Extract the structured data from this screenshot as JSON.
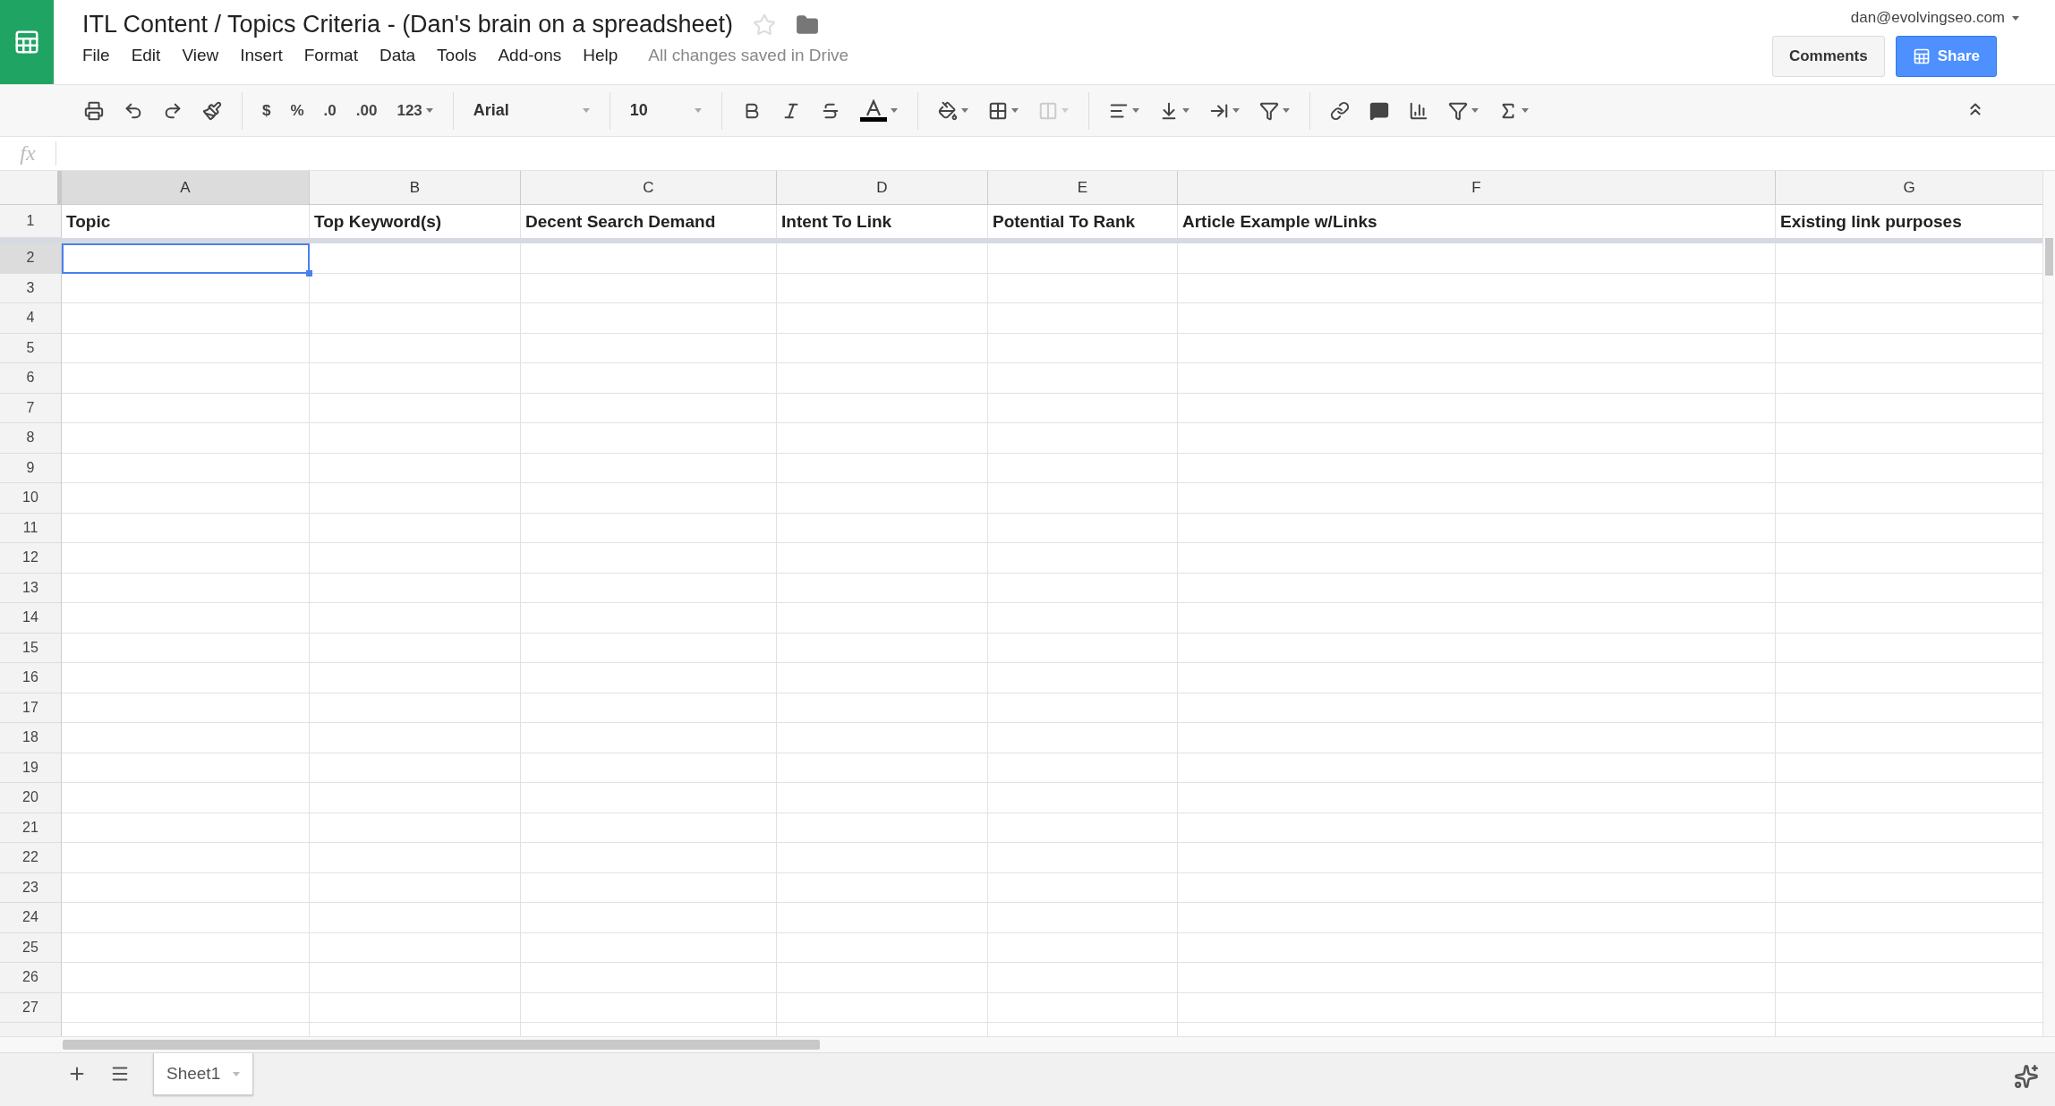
{
  "document": {
    "title": "ITL Content / Topics Criteria - (Dan's brain on a spreadsheet)",
    "starred": false
  },
  "menus": [
    "File",
    "Edit",
    "View",
    "Insert",
    "Format",
    "Data",
    "Tools",
    "Add-ons",
    "Help"
  ],
  "save_status": "All changes saved in Drive",
  "account": {
    "email": "dan@evolvingseo.com"
  },
  "buttons": {
    "comments": "Comments",
    "share": "Share"
  },
  "toolbar": {
    "format_buttons": [
      "$",
      "%",
      ".0",
      ".00",
      "123"
    ],
    "font": "Arial",
    "font_size": "10"
  },
  "formula_bar": {
    "label": "fx"
  },
  "columns": [
    {
      "label": "A",
      "selected": true
    },
    {
      "label": "B",
      "selected": false
    },
    {
      "label": "C",
      "selected": false
    },
    {
      "label": "D",
      "selected": false
    },
    {
      "label": "E",
      "selected": false
    },
    {
      "label": "F",
      "selected": false
    },
    {
      "label": "G",
      "selected": false
    }
  ],
  "header_row": {
    "number": "1",
    "cells": [
      "Topic",
      "Top Keyword(s)",
      "Decent Search Demand",
      "Intent To Link",
      "Potential To Rank",
      "Article Example w/Links",
      "Existing link purposes"
    ]
  },
  "rows": [
    {
      "number": "2",
      "selected": true
    },
    {
      "number": "3",
      "selected": false
    },
    {
      "number": "4",
      "selected": false
    },
    {
      "number": "5",
      "selected": false
    },
    {
      "number": "6",
      "selected": false
    },
    {
      "number": "7",
      "selected": false
    },
    {
      "number": "8",
      "selected": false
    },
    {
      "number": "9",
      "selected": false
    },
    {
      "number": "10",
      "selected": false
    },
    {
      "number": "11",
      "selected": false
    },
    {
      "number": "12",
      "selected": false
    },
    {
      "number": "13",
      "selected": false
    },
    {
      "number": "14",
      "selected": false
    },
    {
      "number": "15",
      "selected": false
    },
    {
      "number": "16",
      "selected": false
    },
    {
      "number": "17",
      "selected": false
    },
    {
      "number": "18",
      "selected": false
    },
    {
      "number": "19",
      "selected": false
    },
    {
      "number": "20",
      "selected": false
    },
    {
      "number": "21",
      "selected": false
    },
    {
      "number": "22",
      "selected": false
    },
    {
      "number": "23",
      "selected": false
    },
    {
      "number": "24",
      "selected": false
    },
    {
      "number": "25",
      "selected": false
    },
    {
      "number": "26",
      "selected": false
    },
    {
      "number": "27",
      "selected": false
    }
  ],
  "sheets": [
    {
      "name": "Sheet1",
      "selected": true
    }
  ]
}
